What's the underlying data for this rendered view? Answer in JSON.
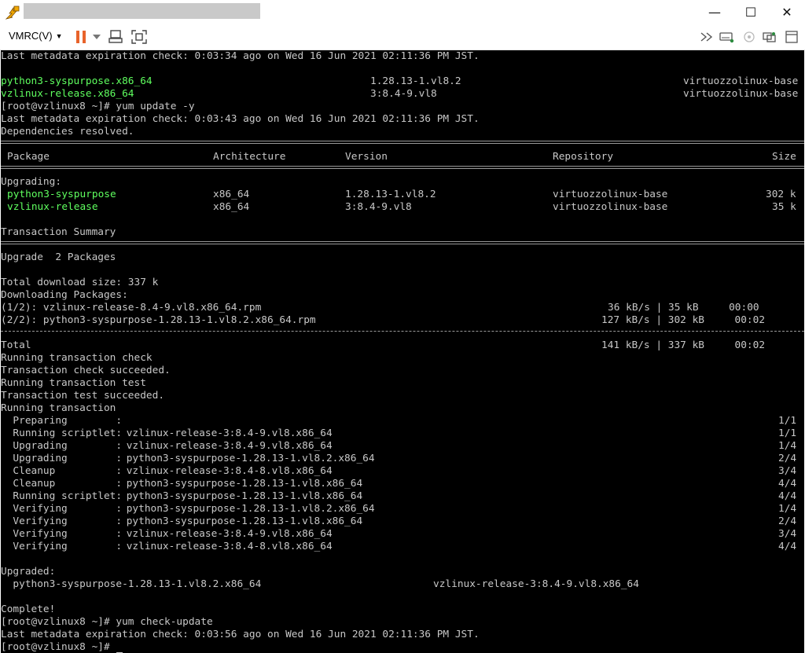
{
  "toolbar": {
    "menu_label": "VMRC(V)"
  },
  "terminal": {
    "lines": [
      "Last metadata expiration check: 0:03:34 ago on Wed 16 Jun 2021 02:11:36 PM JST.",
      "",
      "",
      "",
      "[root@vzlinux8 ~]# yum update -y",
      "Last metadata expiration check: 0:03:43 ago on Wed 16 Jun 2021 02:11:36 PM JST.",
      "Dependencies resolved."
    ],
    "check_update_rows": [
      {
        "name": "python3-syspurpose.x86_64",
        "version": "1.28.13-1.vl8.2",
        "repo": "virtuozzolinux-base"
      },
      {
        "name": "vzlinux-release.x86_64",
        "version": "3:8.4-9.vl8",
        "repo": "virtuozzolinux-base"
      }
    ],
    "table_headers": {
      "package": "Package",
      "arch": "Architecture",
      "version": "Version",
      "repo": "Repository",
      "size": "Size"
    },
    "upgrading_label": "Upgrading:",
    "packages": [
      {
        "name": "python3-syspurpose",
        "arch": "x86_64",
        "version": "1.28.13-1.vl8.2",
        "repo": "virtuozzolinux-base",
        "size": "302 k"
      },
      {
        "name": "vzlinux-release",
        "arch": "x86_64",
        "version": "3:8.4-9.vl8",
        "repo": "virtuozzolinux-base",
        "size": "35 k"
      }
    ],
    "transaction_summary": "Transaction Summary",
    "upgrade_count": "Upgrade  2 Packages",
    "total_download": "Total download size: 337 k",
    "downloading": "Downloading Packages:",
    "downloads": [
      {
        "file": "(1/2): vzlinux-release-8.4-9.vl8.x86_64.rpm",
        "stats": "36 kB/s | 35 kB     00:00"
      },
      {
        "file": "(2/2): python3-syspurpose-1.28.13-1.vl8.2.x86_64.rpm",
        "stats": "127 kB/s | 302 kB     00:02"
      }
    ],
    "total": {
      "label": "Total",
      "stats": "141 kB/s | 337 kB     00:02"
    },
    "tx_lines": [
      "Running transaction check",
      "Transaction check succeeded.",
      "Running transaction test",
      "Transaction test succeeded.",
      "Running transaction"
    ],
    "steps": [
      {
        "action": "  Preparing        :",
        "pkg": "",
        "count": "1/1"
      },
      {
        "action": "  Running scriptlet:",
        "pkg": " vzlinux-release-3:8.4-9.vl8.x86_64",
        "count": "1/1"
      },
      {
        "action": "  Upgrading        :",
        "pkg": " vzlinux-release-3:8.4-9.vl8.x86_64",
        "count": "1/4"
      },
      {
        "action": "  Upgrading        :",
        "pkg": " python3-syspurpose-1.28.13-1.vl8.2.x86_64",
        "count": "2/4"
      },
      {
        "action": "  Cleanup          :",
        "pkg": " vzlinux-release-3:8.4-8.vl8.x86_64",
        "count": "3/4"
      },
      {
        "action": "  Cleanup          :",
        "pkg": " python3-syspurpose-1.28.13-1.vl8.x86_64",
        "count": "4/4"
      },
      {
        "action": "  Running scriptlet:",
        "pkg": " python3-syspurpose-1.28.13-1.vl8.x86_64",
        "count": "4/4"
      },
      {
        "action": "  Verifying        :",
        "pkg": " python3-syspurpose-1.28.13-1.vl8.2.x86_64",
        "count": "1/4"
      },
      {
        "action": "  Verifying        :",
        "pkg": " python3-syspurpose-1.28.13-1.vl8.x86_64",
        "count": "2/4"
      },
      {
        "action": "  Verifying        :",
        "pkg": " vzlinux-release-3:8.4-9.vl8.x86_64",
        "count": "3/4"
      },
      {
        "action": "  Verifying        :",
        "pkg": " vzlinux-release-3:8.4-8.vl8.x86_64",
        "count": "4/4"
      }
    ],
    "upgraded_label": "Upgraded:",
    "upgraded": {
      "left": "  python3-syspurpose-1.28.13-1.vl8.2.x86_64",
      "right": "vzlinux-release-3:8.4-9.vl8.x86_64"
    },
    "complete": "Complete!",
    "check_update_cmd": "[root@vzlinux8 ~]# yum check-update",
    "last_check": "Last metadata expiration check: 0:03:56 ago on Wed 16 Jun 2021 02:11:36 PM JST.",
    "prompt": "[root@vzlinux8 ~]# "
  },
  "colors": {
    "terminal_bg": "#000000",
    "terminal_fg": "#c8c8c8",
    "highlight": "#5fff5f",
    "pause": "#e8632b"
  },
  "icons": [
    "vmrc-app-icon",
    "minimize-icon",
    "maximize-icon",
    "close-icon",
    "pause-icon",
    "dropdown-icon",
    "send-keys-icon",
    "fullscreen-icon",
    "forward-icon",
    "removable-devices-icon",
    "unity-icon",
    "screen-icon",
    "help-icon"
  ]
}
